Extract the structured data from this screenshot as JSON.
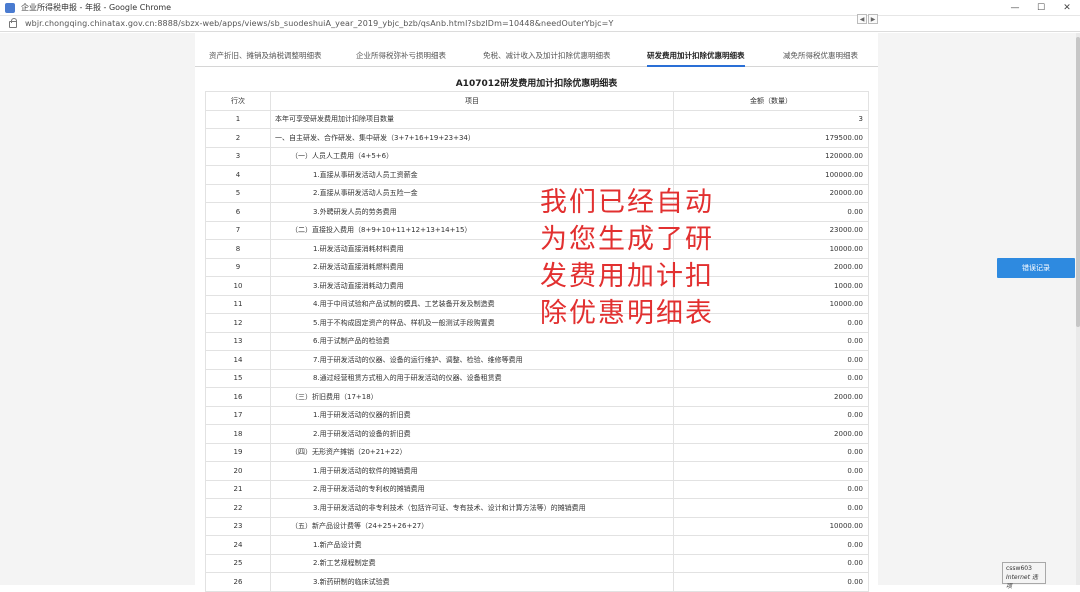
{
  "window": {
    "title": "企业所得税申报 - 年报 - Google Chrome",
    "controls": [
      "—",
      "☐",
      "✕"
    ]
  },
  "address": {
    "url": "wbjr.chongqing.chinatax.gov.cn:8888/sbzx-web/apps/views/sb_suodeshuiA_year_2019_ybjc_bzb/qsAnb.html?sbzlDm=10448&needOuterYbjc=Y"
  },
  "tabs": [
    {
      "label": "资产折旧、摊销及纳税调整明细表",
      "active": false
    },
    {
      "label": "企业所得税弥补亏损明细表",
      "active": false
    },
    {
      "label": "免税、减计收入及加计扣除优惠明细表",
      "active": false
    },
    {
      "label": "研发费用加计扣除优惠明细表",
      "active": true
    },
    {
      "label": "减免所得税优惠明细表",
      "active": false
    }
  ],
  "tab_arrows": [
    "◀",
    "▶"
  ],
  "form": {
    "title": "A107012研发费用加计扣除优惠明细表",
    "headers": {
      "no": "行次",
      "item": "项目",
      "amount": "金额（数量）"
    },
    "rows": [
      {
        "no": "1",
        "item": "本年可享受研发费用加计扣除项目数量",
        "amount": "3",
        "level": 0
      },
      {
        "no": "2",
        "item": "一、自主研发、合作研发、集中研发（3+7+16+19+23+34）",
        "amount": "179500.00",
        "level": 0
      },
      {
        "no": "3",
        "item": "（一）人员人工费用（4+5+6）",
        "amount": "120000.00",
        "level": 1
      },
      {
        "no": "4",
        "item": "1.直接从事研发活动人员工资薪金",
        "amount": "100000.00",
        "level": 2
      },
      {
        "no": "5",
        "item": "2.直接从事研发活动人员五险一金",
        "amount": "20000.00",
        "level": 2
      },
      {
        "no": "6",
        "item": "3.外聘研发人员的劳务费用",
        "amount": "0.00",
        "level": 2
      },
      {
        "no": "7",
        "item": "（二）直接投入费用（8+9+10+11+12+13+14+15）",
        "amount": "23000.00",
        "level": 1
      },
      {
        "no": "8",
        "item": "1.研发活动直接消耗材料费用",
        "amount": "10000.00",
        "level": 2
      },
      {
        "no": "9",
        "item": "2.研发活动直接消耗燃料费用",
        "amount": "2000.00",
        "level": 2
      },
      {
        "no": "10",
        "item": "3.研发活动直接消耗动力费用",
        "amount": "1000.00",
        "level": 2
      },
      {
        "no": "11",
        "item": "4.用于中间试验和产品试制的模具、工艺装备开发及制造费",
        "amount": "10000.00",
        "level": 2
      },
      {
        "no": "12",
        "item": "5.用于不构成固定资产的样品、样机及一般测试手段购置费",
        "amount": "0.00",
        "level": 2
      },
      {
        "no": "13",
        "item": "6.用于试制产品的检验费",
        "amount": "0.00",
        "level": 2
      },
      {
        "no": "14",
        "item": "7.用于研发活动的仪器、设备的运行维护、调整、检验、维修等费用",
        "amount": "0.00",
        "level": 2
      },
      {
        "no": "15",
        "item": "8.通过经营租赁方式租入的用于研发活动的仪器、设备租赁费",
        "amount": "0.00",
        "level": 2
      },
      {
        "no": "16",
        "item": "（三）折旧费用（17+18）",
        "amount": "2000.00",
        "level": 1
      },
      {
        "no": "17",
        "item": "1.用于研发活动的仪器的折旧费",
        "amount": "0.00",
        "level": 2
      },
      {
        "no": "18",
        "item": "2.用于研发活动的设备的折旧费",
        "amount": "2000.00",
        "level": 2
      },
      {
        "no": "19",
        "item": "（四）无形资产摊销（20+21+22）",
        "amount": "0.00",
        "level": 1
      },
      {
        "no": "20",
        "item": "1.用于研发活动的软件的摊销费用",
        "amount": "0.00",
        "level": 2
      },
      {
        "no": "21",
        "item": "2.用于研发活动的专利权的摊销费用",
        "amount": "0.00",
        "level": 2
      },
      {
        "no": "22",
        "item": "3.用于研发活动的非专利技术（包括许可证、专有技术、设计和计算方法等）的摊销费用",
        "amount": "0.00",
        "level": 2
      },
      {
        "no": "23",
        "item": "（五）新产品设计费等（24+25+26+27）",
        "amount": "10000.00",
        "level": 1
      },
      {
        "no": "24",
        "item": "1.新产品设计费",
        "amount": "0.00",
        "level": 2
      },
      {
        "no": "25",
        "item": "2.新工艺规程制定费",
        "amount": "0.00",
        "level": 2
      },
      {
        "no": "26",
        "item": "3.新药研制的临床试验费",
        "amount": "0.00",
        "level": 2
      }
    ]
  },
  "overlay": {
    "lines": [
      "我们已经自动",
      "为您生成了研",
      "发费用加计扣",
      "除优惠明细表"
    ],
    "color": "#e23030"
  },
  "error_button": {
    "label": "错误记录",
    "color": "#2e8ae0"
  },
  "status_widget": {
    "line1": "cssw603",
    "line2": "Internet 选项"
  }
}
